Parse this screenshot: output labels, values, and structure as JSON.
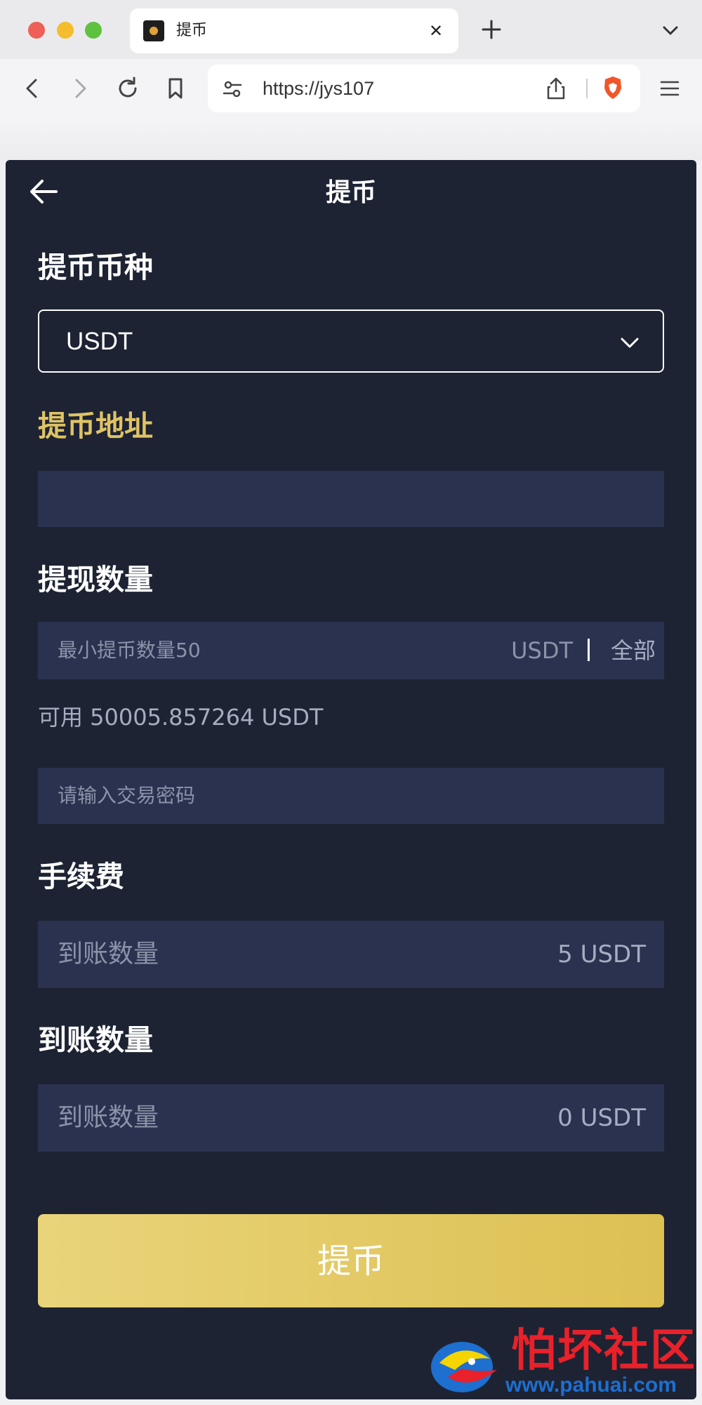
{
  "browser": {
    "tab_title": "提币",
    "tab_close": "✕",
    "address_url": "https://jys107"
  },
  "page": {
    "title": "提币",
    "coin_section": {
      "label": "提币币种",
      "selected_coin": "USDT"
    },
    "address_section": {
      "label": "提币地址",
      "value": ""
    },
    "amount_section": {
      "label": "提现数量",
      "placeholder": "最小提币数量50",
      "unit": "USDT",
      "all_button": "全部",
      "available_text": "可用 50005.857264 USDT"
    },
    "password_field": {
      "placeholder": "请输入交易密码"
    },
    "fee_section": {
      "label": "手续费",
      "field_label": "到账数量",
      "value": "5 USDT"
    },
    "received_section": {
      "label": "到账数量",
      "field_label": "到账数量",
      "value": "0 USDT"
    },
    "submit_button": "提币"
  },
  "watermark": {
    "text": "怕坏社区",
    "url": "www.pahuai.com"
  },
  "colors": {
    "panel_bg": "#1d2333",
    "field_bg": "#2a3250",
    "gold_label": "#dfc365",
    "button_gold": "#ddc052"
  }
}
